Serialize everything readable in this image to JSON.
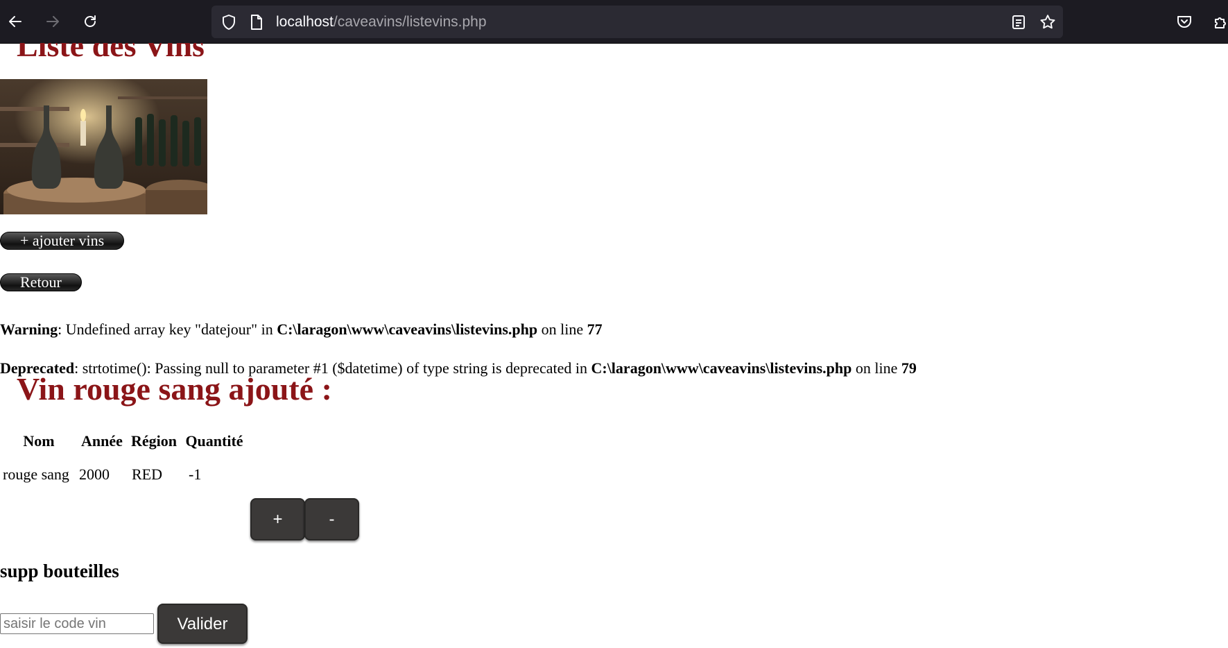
{
  "browser": {
    "url_host": "localhost",
    "url_path": "/caveavins/listevins.php",
    "icons": [
      "back-arrow-icon",
      "forward-arrow-icon",
      "reload-icon",
      "shield-icon",
      "page-icon",
      "reader-view-icon",
      "bookmark-star-icon",
      "pocket-icon",
      "extensions-icon"
    ]
  },
  "page": {
    "heading": "Liste des Vins",
    "image_alt": "cellar-bottles-photo",
    "add_button": "+ ajouter vins",
    "back_button": "Retour",
    "warning": {
      "label": "Warning",
      "text_before": ": Undefined array key \"datejour\" in ",
      "path": "C:\\laragon\\www\\caveavins\\listevins.php",
      "text_mid": " on line ",
      "line": "77"
    },
    "deprecated": {
      "label": "Deprecated",
      "text_before": ": strtotime(): Passing null to parameter #1 ($datetime) of type string is deprecated in ",
      "path": "C:\\laragon\\www\\caveavins\\listevins.php",
      "text_mid": " on line ",
      "line": "79"
    },
    "added_heading": "Vin rouge sang ajouté :",
    "table": {
      "headers": [
        "Nom",
        "Année",
        "Région",
        "Quantité"
      ],
      "row": [
        "rouge sang",
        "2000",
        "RED",
        "-1"
      ]
    },
    "plus_button": "+",
    "minus_button": "-",
    "supp_heading": "supp bouteilles",
    "code_placeholder": "saisir le code vin",
    "validate_button": "Valider"
  },
  "colors": {
    "heading": "#8b1518",
    "toolbar_bg": "#1c1b22",
    "urlbar_bg": "#2b2a33",
    "button_bg": "#3b3938"
  }
}
